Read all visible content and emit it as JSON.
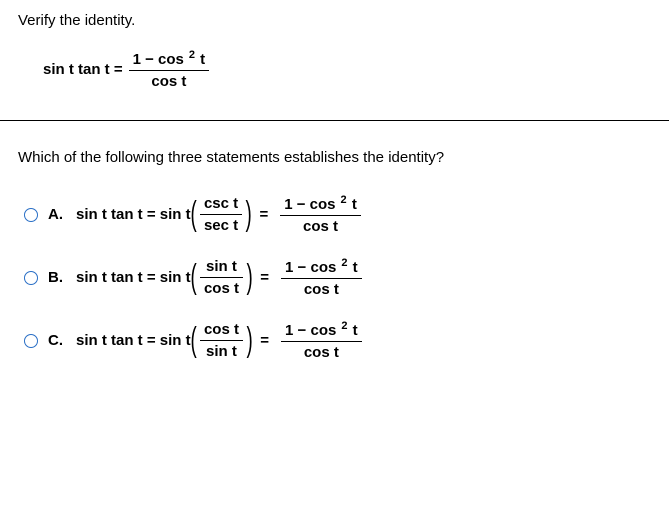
{
  "instruction": "Verify the identity.",
  "identity": {
    "lhs": "sin t tan t =",
    "rhs_num_pre": "1 − cos",
    "rhs_num_exp": "2",
    "rhs_num_post": " t",
    "rhs_den": "cos t"
  },
  "question": "Which of the following three statements establishes the identity?",
  "options": [
    {
      "letter": "A.",
      "lhs": "sin t tan t = sin t",
      "mid_num": "csc t",
      "mid_den": "sec t",
      "rhs_num_pre": "1 − cos",
      "rhs_num_exp": "2",
      "rhs_num_post": " t",
      "rhs_den": "cos t"
    },
    {
      "letter": "B.",
      "lhs": "sin t tan t = sin t",
      "mid_num": "sin t",
      "mid_den": "cos t",
      "rhs_num_pre": "1 − cos",
      "rhs_num_exp": "2",
      "rhs_num_post": " t",
      "rhs_den": "cos t"
    },
    {
      "letter": "C.",
      "lhs": "sin t tan t = sin t",
      "mid_num": "cos t",
      "mid_den": "sin t",
      "rhs_num_pre": "1 − cos",
      "rhs_num_exp": "2",
      "rhs_num_post": " t",
      "rhs_den": "cos t"
    }
  ]
}
